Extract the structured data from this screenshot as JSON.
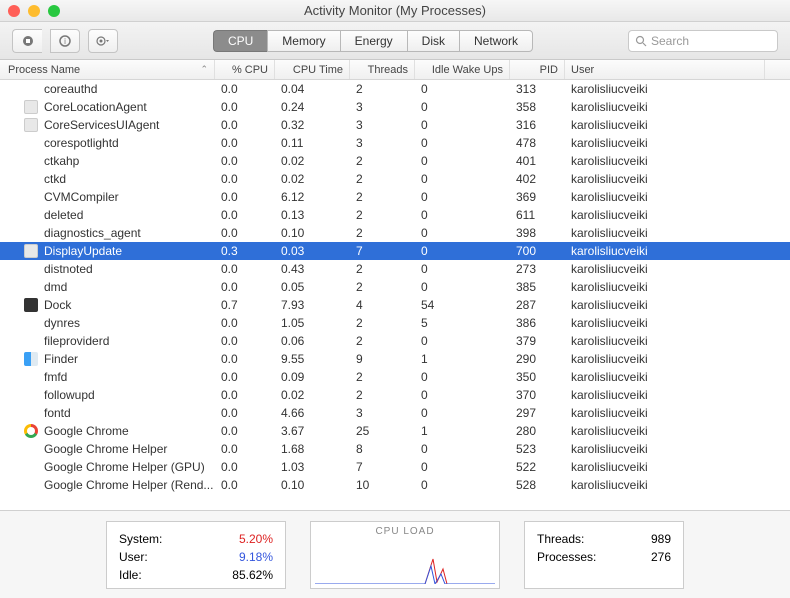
{
  "title": "Activity Monitor (My Processes)",
  "search_placeholder": "Search",
  "tabs": {
    "cpu": "CPU",
    "memory": "Memory",
    "energy": "Energy",
    "disk": "Disk",
    "network": "Network"
  },
  "columns": {
    "name": "Process Name",
    "cpu": "% CPU",
    "time": "CPU Time",
    "threads": "Threads",
    "wake": "Idle Wake Ups",
    "pid": "PID",
    "user": "User"
  },
  "rows": [
    {
      "name": "coreauthd",
      "cpu": "0.0",
      "time": "0.04",
      "threads": "2",
      "wake": "0",
      "pid": "313",
      "user": "karolisliucveiki",
      "icon": "blank"
    },
    {
      "name": "CoreLocationAgent",
      "cpu": "0.0",
      "time": "0.24",
      "threads": "3",
      "wake": "0",
      "pid": "358",
      "user": "karolisliucveiki",
      "icon": "app"
    },
    {
      "name": "CoreServicesUIAgent",
      "cpu": "0.0",
      "time": "0.32",
      "threads": "3",
      "wake": "0",
      "pid": "316",
      "user": "karolisliucveiki",
      "icon": "app"
    },
    {
      "name": "corespotlightd",
      "cpu": "0.0",
      "time": "0.11",
      "threads": "3",
      "wake": "0",
      "pid": "478",
      "user": "karolisliucveiki",
      "icon": "blank"
    },
    {
      "name": "ctkahp",
      "cpu": "0.0",
      "time": "0.02",
      "threads": "2",
      "wake": "0",
      "pid": "401",
      "user": "karolisliucveiki",
      "icon": "blank"
    },
    {
      "name": "ctkd",
      "cpu": "0.0",
      "time": "0.02",
      "threads": "2",
      "wake": "0",
      "pid": "402",
      "user": "karolisliucveiki",
      "icon": "blank"
    },
    {
      "name": "CVMCompiler",
      "cpu": "0.0",
      "time": "6.12",
      "threads": "2",
      "wake": "0",
      "pid": "369",
      "user": "karolisliucveiki",
      "icon": "blank"
    },
    {
      "name": "deleted",
      "cpu": "0.0",
      "time": "0.13",
      "threads": "2",
      "wake": "0",
      "pid": "611",
      "user": "karolisliucveiki",
      "icon": "blank"
    },
    {
      "name": "diagnostics_agent",
      "cpu": "0.0",
      "time": "0.10",
      "threads": "2",
      "wake": "0",
      "pid": "398",
      "user": "karolisliucveiki",
      "icon": "blank"
    },
    {
      "name": "DisplayUpdate",
      "cpu": "0.3",
      "time": "0.03",
      "threads": "7",
      "wake": "0",
      "pid": "700",
      "user": "karolisliucveiki",
      "icon": "app",
      "selected": true
    },
    {
      "name": "distnoted",
      "cpu": "0.0",
      "time": "0.43",
      "threads": "2",
      "wake": "0",
      "pid": "273",
      "user": "karolisliucveiki",
      "icon": "blank"
    },
    {
      "name": "dmd",
      "cpu": "0.0",
      "time": "0.05",
      "threads": "2",
      "wake": "0",
      "pid": "385",
      "user": "karolisliucveiki",
      "icon": "blank"
    },
    {
      "name": "Dock",
      "cpu": "0.7",
      "time": "7.93",
      "threads": "4",
      "wake": "54",
      "pid": "287",
      "user": "karolisliucveiki",
      "icon": "dock"
    },
    {
      "name": "dynres",
      "cpu": "0.0",
      "time": "1.05",
      "threads": "2",
      "wake": "5",
      "pid": "386",
      "user": "karolisliucveiki",
      "icon": "blank"
    },
    {
      "name": "fileproviderd",
      "cpu": "0.0",
      "time": "0.06",
      "threads": "2",
      "wake": "0",
      "pid": "379",
      "user": "karolisliucveiki",
      "icon": "blank"
    },
    {
      "name": "Finder",
      "cpu": "0.0",
      "time": "9.55",
      "threads": "9",
      "wake": "1",
      "pid": "290",
      "user": "karolisliucveiki",
      "icon": "finder"
    },
    {
      "name": "fmfd",
      "cpu": "0.0",
      "time": "0.09",
      "threads": "2",
      "wake": "0",
      "pid": "350",
      "user": "karolisliucveiki",
      "icon": "blank"
    },
    {
      "name": "followupd",
      "cpu": "0.0",
      "time": "0.02",
      "threads": "2",
      "wake": "0",
      "pid": "370",
      "user": "karolisliucveiki",
      "icon": "blank"
    },
    {
      "name": "fontd",
      "cpu": "0.0",
      "time": "4.66",
      "threads": "3",
      "wake": "0",
      "pid": "297",
      "user": "karolisliucveiki",
      "icon": "blank"
    },
    {
      "name": "Google Chrome",
      "cpu": "0.0",
      "time": "3.67",
      "threads": "25",
      "wake": "1",
      "pid": "280",
      "user": "karolisliucveiki",
      "icon": "chrome"
    },
    {
      "name": "Google Chrome Helper",
      "cpu": "0.0",
      "time": "1.68",
      "threads": "8",
      "wake": "0",
      "pid": "523",
      "user": "karolisliucveiki",
      "icon": "blank"
    },
    {
      "name": "Google Chrome Helper (GPU)",
      "cpu": "0.0",
      "time": "1.03",
      "threads": "7",
      "wake": "0",
      "pid": "522",
      "user": "karolisliucveiki",
      "icon": "blank"
    },
    {
      "name": "Google Chrome Helper (Rend...",
      "cpu": "0.0",
      "time": "0.10",
      "threads": "10",
      "wake": "0",
      "pid": "528",
      "user": "karolisliucveiki",
      "icon": "blank"
    }
  ],
  "footer": {
    "system_label": "System:",
    "system_val": "5.20%",
    "user_label": "User:",
    "user_val": "9.18%",
    "idle_label": "Idle:",
    "idle_val": "85.62%",
    "cpu_load_label": "CPU LOAD",
    "threads_label": "Threads:",
    "threads_val": "989",
    "proc_label": "Processes:",
    "proc_val": "276"
  }
}
